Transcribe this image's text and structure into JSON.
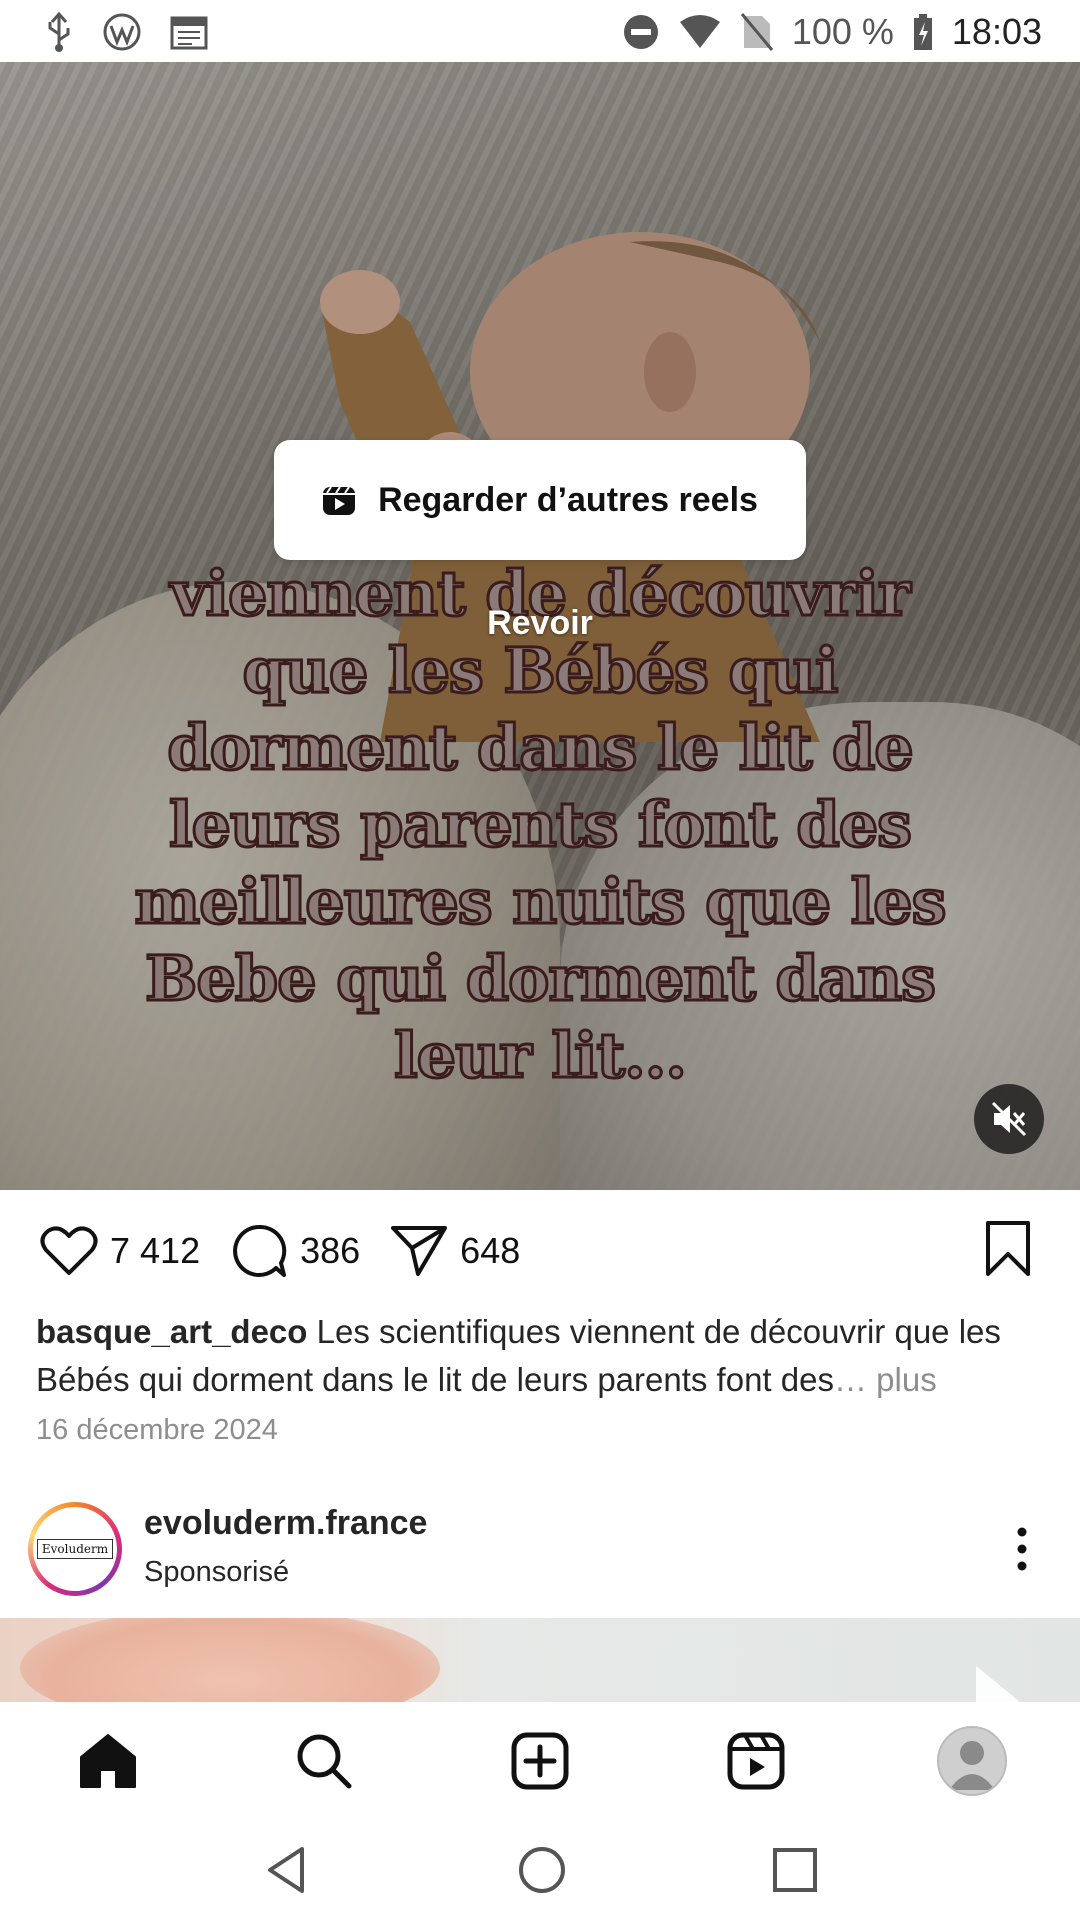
{
  "status_bar": {
    "battery": "100 %",
    "time": "18:03",
    "icons": [
      "usb-icon",
      "wordpress-icon",
      "calendar-icon",
      "do-not-disturb-icon",
      "wifi-icon",
      "no-sim-icon",
      "battery-charging-icon"
    ]
  },
  "post": {
    "overlay_text": "viennent de découvrir que les Bébés qui dorment dans le lit de leurs parents font des meilleures nuits que les Bebe qui dorment dans leur lit...",
    "reels_button_label": "Regarder d’autres reels",
    "replay_label": "Revoir",
    "likes": "7 412",
    "comments": "386",
    "shares": "648",
    "caption_user": "basque_art_deco",
    "caption_text": " Les scientifiques viennent de découvrir que les Bébés qui dorment dans le lit de leurs parents font des",
    "caption_more": "… plus",
    "date": "16 décembre 2024"
  },
  "next_post": {
    "account": "evoluderm.france",
    "subtitle": "Sponsorisé",
    "avatar_logo_text": "Evoluderm"
  },
  "bottom_nav": {
    "items": [
      "home-icon",
      "search-icon",
      "create-icon",
      "reels-icon",
      "profile-avatar"
    ]
  },
  "colors": {
    "muted_text": "#8e8e8e",
    "primary_text": "#262626"
  }
}
